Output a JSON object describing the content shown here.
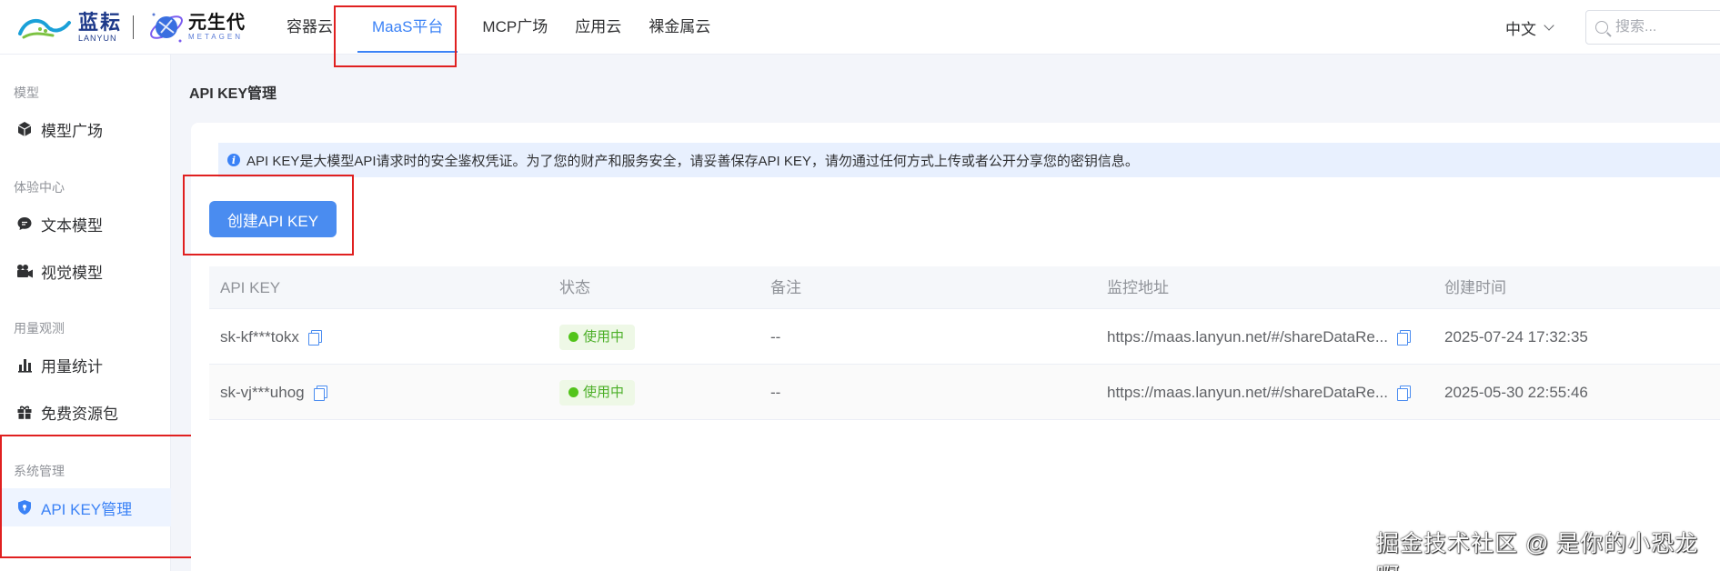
{
  "brand": {
    "lanyun_cn": "蓝耘",
    "lanyun_en": "LANYUN",
    "metagen_cn": "元生代",
    "metagen_en": "METAGEN"
  },
  "nav": {
    "items": [
      "容器云",
      "MaaS平台",
      "MCP广场",
      "应用云",
      "裸金属云"
    ],
    "active": "MaaS平台",
    "language": "中文",
    "search_placeholder": "搜索..."
  },
  "sidebar": {
    "groups": [
      {
        "label": "模型",
        "items": [
          {
            "label": "模型广场",
            "icon": "cube-icon"
          }
        ]
      },
      {
        "label": "体验中心",
        "items": [
          {
            "label": "文本模型",
            "icon": "chat-bubble-icon"
          },
          {
            "label": "视觉模型",
            "icon": "video-camera-icon"
          }
        ]
      },
      {
        "label": "用量观测",
        "items": [
          {
            "label": "用量统计",
            "icon": "bar-chart-icon"
          },
          {
            "label": "免费资源包",
            "icon": "gift-icon"
          }
        ]
      },
      {
        "label": "系统管理",
        "items": [
          {
            "label": "API KEY管理",
            "icon": "shield-icon",
            "active": true
          }
        ]
      }
    ]
  },
  "page": {
    "title": "API KEY管理",
    "notice": "API KEY是大模型API请求时的安全鉴权凭证。为了您的财产和服务安全，请妥善保存API KEY，请勿通过任何方式上传或者公开分享您的密钥信息。",
    "create_button": "创建API KEY"
  },
  "table": {
    "headers": [
      "API KEY",
      "状态",
      "备注",
      "监控地址",
      "创建时间"
    ],
    "rows": [
      {
        "key": "sk-kf***tokx",
        "status": "使用中",
        "remark": "--",
        "url": "https://maas.lanyun.net/#/shareDataRe...",
        "created": "2025-07-24 17:32:35"
      },
      {
        "key": "sk-vj***uhog",
        "status": "使用中",
        "remark": "--",
        "url": "https://maas.lanyun.net/#/shareDataRe...",
        "created": "2025-05-30 22:55:46"
      }
    ]
  },
  "watermark": "掘金技术社区 @ 是你的小恐龙啊",
  "colors": {
    "accent": "#3b82f6",
    "highlight_box": "#e02020",
    "status_green": "#52c41a"
  }
}
